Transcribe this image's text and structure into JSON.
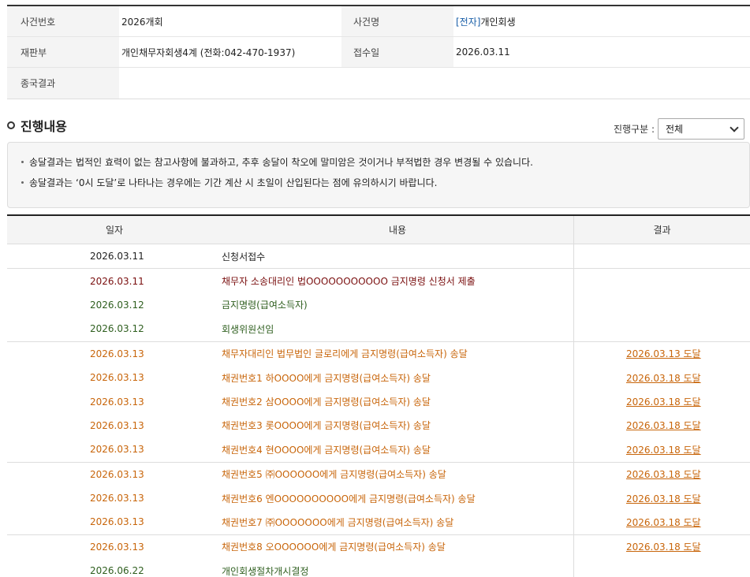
{
  "case_info": {
    "case_no_label": "사건번호",
    "case_no": "2026개회",
    "case_name_label": "사건명",
    "case_name_tag": "[전자]",
    "case_name": "개인회생",
    "court_label": "재판부",
    "court": "개인채무자회생4계 (전화:042-470-1937)",
    "received_label": "접수일",
    "received": "2026.03.11",
    "final_label": "종국결과",
    "final": ""
  },
  "section": {
    "title": "진행내용",
    "filter_label": "진행구분 :",
    "filter_value": "전체"
  },
  "notices": [
    "송달결과는 법적인 효력이 없는 참고사항에 불과하고, 추후 송달이 착오에 말미암은 것이거나 부적법한 경우 변경될 수 있습니다.",
    "송달결과는 ‘0시 도달’로 나타나는 경우에는 기간 계산 시 초일이 산입된다는 점에 유의하시기 바랍니다."
  ],
  "table": {
    "headers": {
      "date": "일자",
      "content": "내용",
      "result": "결과"
    },
    "groups": [
      [
        {
          "date": "2026.03.11",
          "content": "신청서접수",
          "result": "",
          "color": "#222222"
        }
      ],
      [
        {
          "date": "2026.03.11",
          "content": "채무자 소송대리인 법OOOOOOOOOOO 금지명령 신청서 제출",
          "result": "",
          "color": "#7a0f0f"
        },
        {
          "date": "2026.03.12",
          "content": "금지명령(급여소득자)",
          "result": "",
          "color": "#2e5e1e"
        },
        {
          "date": "2026.03.12",
          "content": "회생위원선임",
          "result": "",
          "color": "#2e5e1e"
        }
      ],
      [
        {
          "date": "2026.03.13",
          "content": "채무자대리인 법무법인 글로리에게 금지명령(급여소득자) 송달",
          "result": "2026.03.13 도달",
          "color": "#c8650a"
        },
        {
          "date": "2026.03.13",
          "content": "채권번호1 하OOOO에게 금지명령(급여소득자) 송달",
          "result": "2026.03.18 도달",
          "color": "#c8650a"
        },
        {
          "date": "2026.03.13",
          "content": "채권번호2 삼OOOO에게 금지명령(급여소득자) 송달",
          "result": "2026.03.18 도달",
          "color": "#c8650a"
        },
        {
          "date": "2026.03.13",
          "content": "채권번호3 롯OOOO에게 금지명령(급여소득자) 송달",
          "result": "2026.03.18 도달",
          "color": "#c8650a"
        },
        {
          "date": "2026.03.13",
          "content": "채권번호4 현OOOO에게 금지명령(급여소득자) 송달",
          "result": "2026.03.18 도달",
          "color": "#c8650a"
        }
      ],
      [
        {
          "date": "2026.03.13",
          "content": "채권번호5 ㈜OOOOOO에게 금지명령(급여소득자) 송달",
          "result": "2026.03.18 도달",
          "color": "#c8650a"
        },
        {
          "date": "2026.03.13",
          "content": "채권번호6 엔OOOOOOOOOO에게 금지명령(급여소득자) 송달",
          "result": "2026.03.18 도달",
          "color": "#c8650a"
        },
        {
          "date": "2026.03.13",
          "content": "채권번호7 ㈜OOOOOOO에게 금지명령(급여소득자) 송달",
          "result": "2026.03.18 도달",
          "color": "#c8650a"
        }
      ],
      [
        {
          "date": "2026.03.13",
          "content": "채권번호8 오OOOOOO에게 금지명령(급여소득자) 송달",
          "result": "2026.03.18 도달",
          "color": "#c8650a"
        },
        {
          "date": "2026.06.22",
          "content": "개인회생절차개시결정",
          "result": "",
          "color": "#2e5e1e"
        }
      ]
    ]
  }
}
